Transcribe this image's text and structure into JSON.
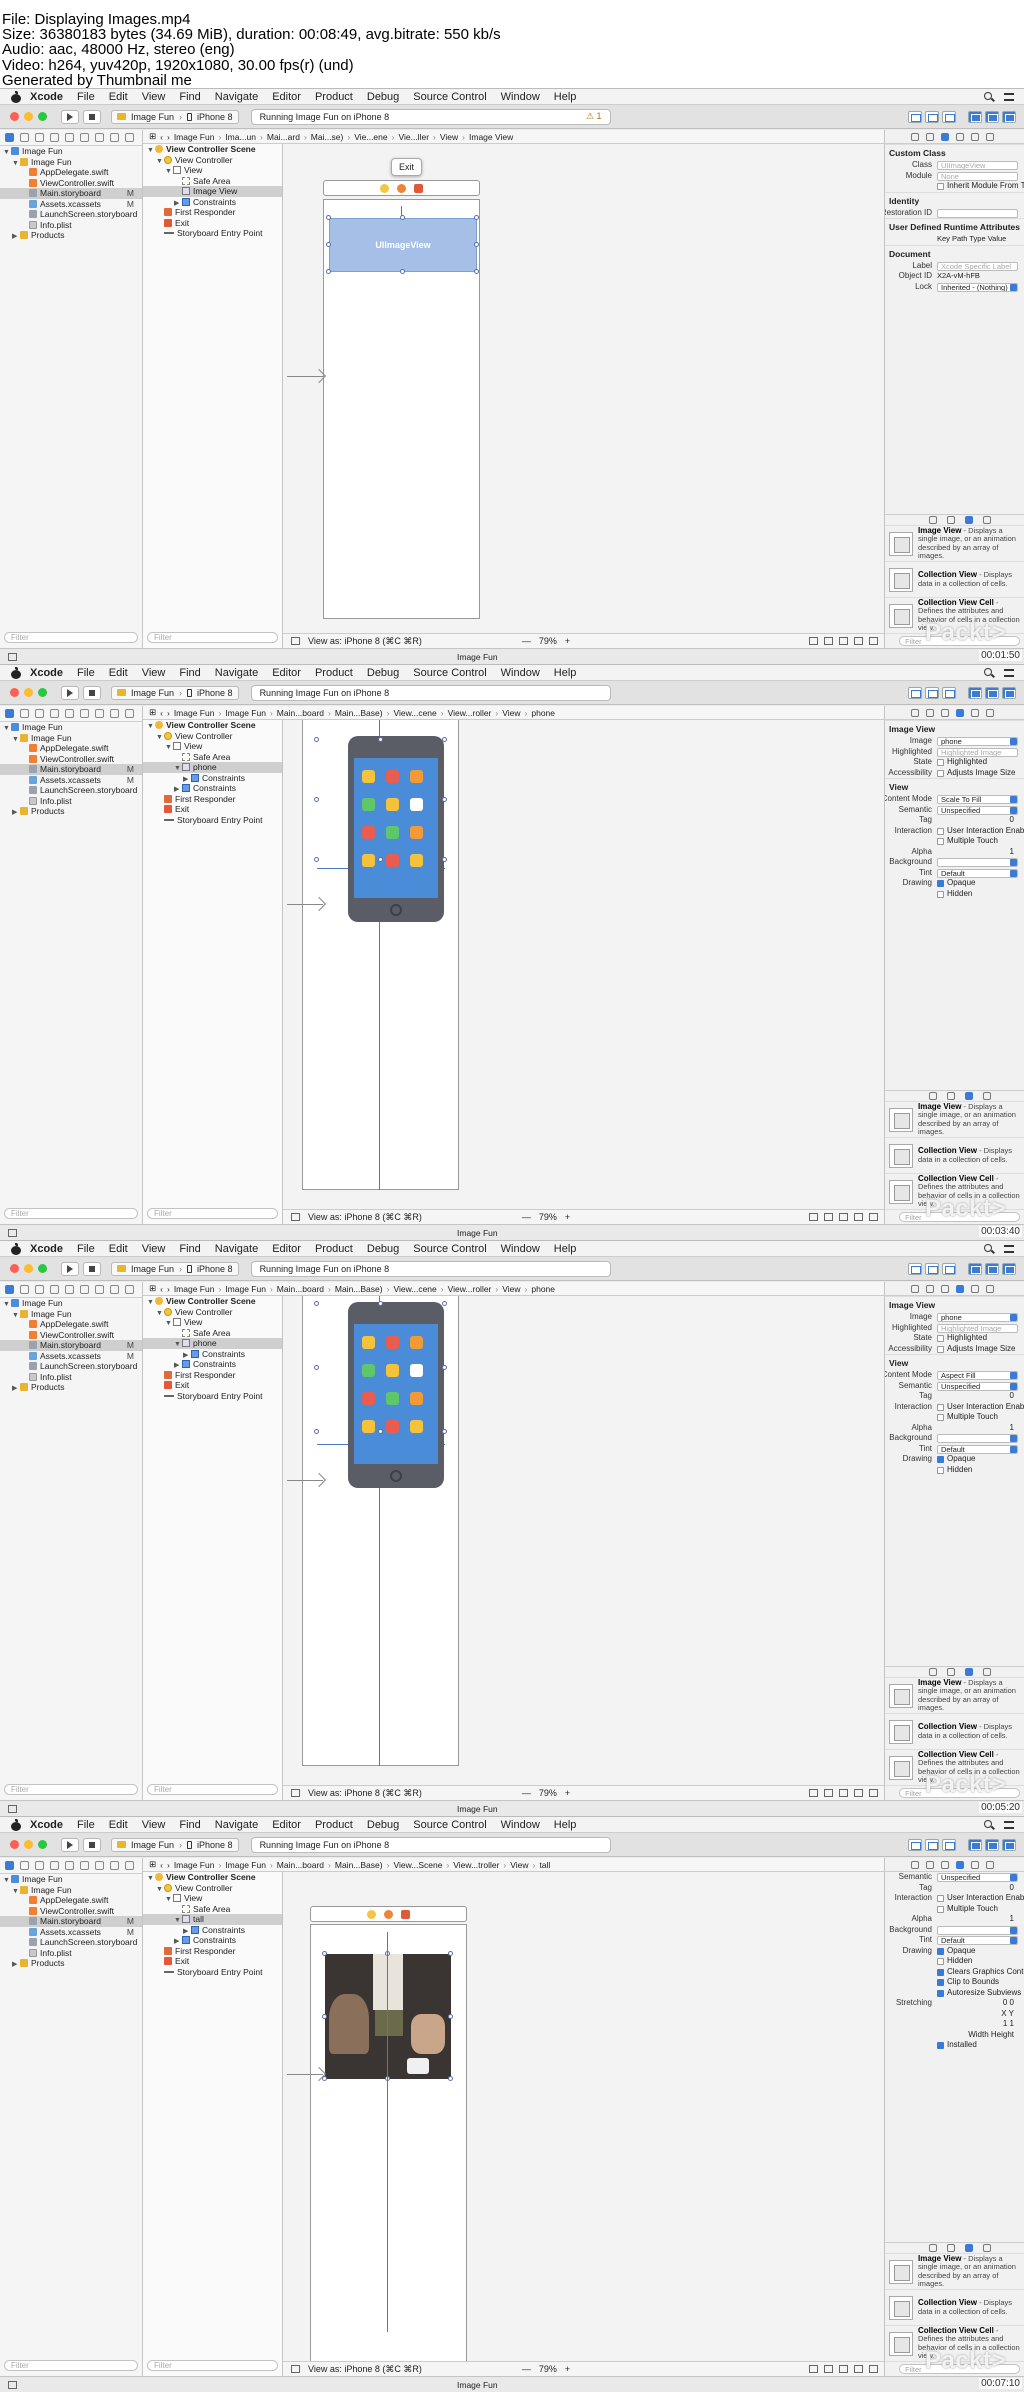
{
  "file_info": {
    "lines": [
      "File: Displaying Images.mp4",
      "Size: 36380183 bytes (34.69 MiB), duration: 00:08:49, avg.bitrate: 550 kb/s",
      "Audio: aac, 48000 Hz, stereo (eng)",
      "Video: h264, yuv420p, 1920x1080, 30.00 fps(r) (und)",
      "Generated by Thumbnail me"
    ]
  },
  "common": {
    "app_name": "Xcode",
    "menu": [
      "File",
      "Edit",
      "View",
      "Find",
      "Navigate",
      "Editor",
      "Product",
      "Debug",
      "Source Control",
      "Window",
      "Help"
    ],
    "scheme": "Image Fun",
    "device": "iPhone 8",
    "status": "Running Image Fun on iPhone 8",
    "nav_items": [
      {
        "label": "Image Fun",
        "icon": "project-icon",
        "indent": 0,
        "disc": "▼"
      },
      {
        "label": "Image Fun",
        "icon": "folder-icon",
        "indent": 1,
        "disc": "▼"
      },
      {
        "label": "AppDelegate.swift",
        "icon": "swift-file-icon",
        "indent": 2,
        "disc": ""
      },
      {
        "label": "ViewController.swift",
        "icon": "swift-file-icon",
        "indent": 2,
        "disc": ""
      },
      {
        "label": "Main.storyboard",
        "icon": "storyboard-file-icon",
        "indent": 2,
        "disc": "",
        "badge": "M",
        "selected": true
      },
      {
        "label": "Assets.xcassets",
        "icon": "assets-file-icon",
        "indent": 2,
        "disc": "",
        "badge": "M"
      },
      {
        "label": "LaunchScreen.storyboard",
        "icon": "storyboard-file-icon",
        "indent": 2,
        "disc": ""
      },
      {
        "label": "Info.plist",
        "icon": "plist-file-icon",
        "indent": 2,
        "disc": ""
      },
      {
        "label": "Products",
        "icon": "folder-icon",
        "indent": 1,
        "disc": "▶"
      }
    ],
    "filter_placeholder": "Filter",
    "view_as": "View as: iPhone 8 (⌘C ⌘R)",
    "debug_label": "Image Fun",
    "library": [
      {
        "title": "Image View",
        "desc": "- Displays a single image, or an animation described by an array of images."
      },
      {
        "title": "Collection View",
        "desc": "- Displays data in a collection of cells."
      },
      {
        "title": "Collection View Cell",
        "desc": "- Defines the attributes and behavior of cells in a collection view."
      }
    ],
    "watermark": "Packt>",
    "colors": {
      "accent": "#3b7bd6",
      "red_light": "#fc5f57",
      "yellow_light": "#fdbc2e",
      "green_light": "#29c840"
    }
  },
  "panels": [
    {
      "timecode": "00:01:50",
      "warn": "⚠ 1",
      "jump": [
        "Image Fun",
        "Ima...un",
        "Mai...ard",
        "Mai...se)",
        "Vie...ene",
        "Vie...ller",
        "View",
        "Image View"
      ],
      "outline": [
        {
          "label": "View Controller Scene",
          "icon": "scene-icon",
          "indent": 0,
          "disc": "▼",
          "bold": true
        },
        {
          "label": "View Controller",
          "icon": "view-controller-icon",
          "indent": 1,
          "disc": "▼"
        },
        {
          "label": "View",
          "icon": "view-icon",
          "indent": 2,
          "disc": "▼"
        },
        {
          "label": "Safe Area",
          "icon": "safe-area-icon",
          "indent": 3,
          "disc": ""
        },
        {
          "label": "Image View",
          "icon": "image-view-icon",
          "indent": 3,
          "disc": "",
          "selected": true
        },
        {
          "label": "Constraints",
          "icon": "constraints-icon",
          "indent": 3,
          "disc": "▶"
        },
        {
          "label": "First Responder",
          "icon": "first-responder-icon",
          "indent": 1,
          "disc": ""
        },
        {
          "label": "Exit",
          "icon": "exit-icon",
          "indent": 1,
          "disc": ""
        },
        {
          "label": "Storyboard Entry Point",
          "icon": "entry-point-icon",
          "indent": 1,
          "disc": ""
        }
      ],
      "zoom": "79%",
      "tooltip": "Exit",
      "image_label": "UIImageView",
      "inspector": {
        "sections": [
          {
            "title": "Custom Class",
            "props": [
              {
                "label": "Class",
                "value": "UIImageView",
                "type": "field-ph"
              },
              {
                "label": "Module",
                "value": "None",
                "type": "field-ph"
              },
              {
                "label": "",
                "value": "Inherit Module From Target",
                "type": "check"
              }
            ]
          },
          {
            "title": "Identity",
            "props": [
              {
                "label": "Restoration ID",
                "value": "",
                "type": "field"
              }
            ]
          },
          {
            "title": "User Defined Runtime Attributes",
            "props": [
              {
                "label": "",
                "value": "Key Path     Type     Value",
                "type": "text"
              }
            ]
          },
          {
            "title": "Document",
            "props": [
              {
                "label": "Label",
                "value": "Xcode Specific Label",
                "type": "field-ph"
              },
              {
                "label": "Object ID",
                "value": "X2A-vM-hFB",
                "type": "text"
              },
              {
                "label": "Lock",
                "value": "Inherited - (Nothing)",
                "type": "pop"
              }
            ]
          }
        ]
      }
    },
    {
      "timecode": "00:03:40",
      "jump": [
        "Image Fun",
        "Image Fun",
        "Main...board",
        "Main...Base)",
        "View...cene",
        "View...roller",
        "View",
        "phone"
      ],
      "outline": [
        {
          "label": "View Controller Scene",
          "icon": "scene-icon",
          "indent": 0,
          "disc": "▼",
          "bold": true
        },
        {
          "label": "View Controller",
          "icon": "view-controller-icon",
          "indent": 1,
          "disc": "▼"
        },
        {
          "label": "View",
          "icon": "view-icon",
          "indent": 2,
          "disc": "▼"
        },
        {
          "label": "Safe Area",
          "icon": "safe-area-icon",
          "indent": 3,
          "disc": ""
        },
        {
          "label": "phone",
          "icon": "image-view-icon",
          "indent": 3,
          "disc": "▼",
          "selected": true
        },
        {
          "label": "Constraints",
          "icon": "constraints-icon",
          "indent": 4,
          "disc": "▶"
        },
        {
          "label": "Constraints",
          "icon": "constraints-icon",
          "indent": 3,
          "disc": "▶"
        },
        {
          "label": "First Responder",
          "icon": "first-responder-icon",
          "indent": 1,
          "disc": ""
        },
        {
          "label": "Exit",
          "icon": "exit-icon",
          "indent": 1,
          "disc": ""
        },
        {
          "label": "Storyboard Entry Point",
          "icon": "entry-point-icon",
          "indent": 1,
          "disc": ""
        }
      ],
      "zoom": "79%",
      "inspector": {
        "sections": [
          {
            "title": "Image View",
            "props": [
              {
                "label": "Image",
                "value": "phone",
                "type": "pop"
              },
              {
                "label": "Highlighted",
                "value": "Highlighted Image",
                "type": "field-ph"
              },
              {
                "label": "State",
                "value": "Highlighted",
                "type": "check"
              },
              {
                "label": "Accessibility",
                "value": "Adjusts Image Size",
                "type": "check"
              }
            ]
          },
          {
            "title": "View",
            "props": [
              {
                "label": "Content Mode",
                "value": "Scale To Fill",
                "type": "pop"
              },
              {
                "label": "Semantic",
                "value": "Unspecified",
                "type": "pop"
              },
              {
                "label": "Tag",
                "value": "0",
                "type": "num"
              },
              {
                "label": "Interaction",
                "value": "User Interaction Enabled",
                "type": "check"
              },
              {
                "label": "",
                "value": "Multiple Touch",
                "type": "check"
              },
              {
                "label": "Alpha",
                "value": "1",
                "type": "num"
              },
              {
                "label": "Background",
                "value": "",
                "type": "pop"
              },
              {
                "label": "Tint",
                "value": "Default",
                "type": "pop"
              },
              {
                "label": "Drawing",
                "value": "Opaque",
                "type": "check-on"
              },
              {
                "label": "",
                "value": "Hidden",
                "type": "check"
              }
            ]
          }
        ]
      }
    },
    {
      "timecode": "00:05:20",
      "jump": [
        "Image Fun",
        "Image Fun",
        "Main...board",
        "Main...Base)",
        "View...cene",
        "View...roller",
        "View",
        "phone"
      ],
      "outline": [
        {
          "label": "View Controller Scene",
          "icon": "scene-icon",
          "indent": 0,
          "disc": "▼",
          "bold": true
        },
        {
          "label": "View Controller",
          "icon": "view-controller-icon",
          "indent": 1,
          "disc": "▼"
        },
        {
          "label": "View",
          "icon": "view-icon",
          "indent": 2,
          "disc": "▼"
        },
        {
          "label": "Safe Area",
          "icon": "safe-area-icon",
          "indent": 3,
          "disc": ""
        },
        {
          "label": "phone",
          "icon": "image-view-icon",
          "indent": 3,
          "disc": "▼",
          "selected": true
        },
        {
          "label": "Constraints",
          "icon": "constraints-icon",
          "indent": 4,
          "disc": "▶"
        },
        {
          "label": "Constraints",
          "icon": "constraints-icon",
          "indent": 3,
          "disc": "▶"
        },
        {
          "label": "First Responder",
          "icon": "first-responder-icon",
          "indent": 1,
          "disc": ""
        },
        {
          "label": "Exit",
          "icon": "exit-icon",
          "indent": 1,
          "disc": ""
        },
        {
          "label": "Storyboard Entry Point",
          "icon": "entry-point-icon",
          "indent": 1,
          "disc": ""
        }
      ],
      "zoom": "79%",
      "inspector": {
        "sections": [
          {
            "title": "Image View",
            "props": [
              {
                "label": "Image",
                "value": "phone",
                "type": "pop"
              },
              {
                "label": "Highlighted",
                "value": "Highlighted Image",
                "type": "field-ph"
              },
              {
                "label": "State",
                "value": "Highlighted",
                "type": "check"
              },
              {
                "label": "Accessibility",
                "value": "Adjusts Image Size",
                "type": "check"
              }
            ]
          },
          {
            "title": "View",
            "props": [
              {
                "label": "Content Mode",
                "value": "Aspect Fill",
                "type": "pop"
              },
              {
                "label": "Semantic",
                "value": "Unspecified",
                "type": "pop"
              },
              {
                "label": "Tag",
                "value": "0",
                "type": "num"
              },
              {
                "label": "Interaction",
                "value": "User Interaction Enabled",
                "type": "check"
              },
              {
                "label": "",
                "value": "Multiple Touch",
                "type": "check"
              },
              {
                "label": "Alpha",
                "value": "1",
                "type": "num"
              },
              {
                "label": "Background",
                "value": "",
                "type": "pop"
              },
              {
                "label": "Tint",
                "value": "Default",
                "type": "pop"
              },
              {
                "label": "Drawing",
                "value": "Opaque",
                "type": "check-on"
              },
              {
                "label": "",
                "value": "Hidden",
                "type": "check"
              }
            ]
          }
        ]
      }
    },
    {
      "timecode": "00:07:10",
      "jump": [
        "Image Fun",
        "Image Fun",
        "Main...board",
        "Main...Base)",
        "View...Scene",
        "View...troller",
        "View",
        "tall"
      ],
      "outline": [
        {
          "label": "View Controller Scene",
          "icon": "scene-icon",
          "indent": 0,
          "disc": "▼",
          "bold": true
        },
        {
          "label": "View Controller",
          "icon": "view-controller-icon",
          "indent": 1,
          "disc": "▼"
        },
        {
          "label": "View",
          "icon": "view-icon",
          "indent": 2,
          "disc": "▼"
        },
        {
          "label": "Safe Area",
          "icon": "safe-area-icon",
          "indent": 3,
          "disc": ""
        },
        {
          "label": "tall",
          "icon": "image-view-icon",
          "indent": 3,
          "disc": "▼",
          "selected": true
        },
        {
          "label": "Constraints",
          "icon": "constraints-icon",
          "indent": 4,
          "disc": "▶"
        },
        {
          "label": "Constraints",
          "icon": "constraints-icon",
          "indent": 3,
          "disc": "▶"
        },
        {
          "label": "First Responder",
          "icon": "first-responder-icon",
          "indent": 1,
          "disc": ""
        },
        {
          "label": "Exit",
          "icon": "exit-icon",
          "indent": 1,
          "disc": ""
        },
        {
          "label": "Storyboard Entry Point",
          "icon": "entry-point-icon",
          "indent": 1,
          "disc": ""
        }
      ],
      "zoom": "79%",
      "inspector": {
        "sections": [
          {
            "title": "",
            "props": [
              {
                "label": "Semantic",
                "value": "Unspecified",
                "type": "pop"
              },
              {
                "label": "Tag",
                "value": "0",
                "type": "num"
              },
              {
                "label": "Interaction",
                "value": "User Interaction Enabled",
                "type": "check"
              },
              {
                "label": "",
                "value": "Multiple Touch",
                "type": "check"
              },
              {
                "label": "Alpha",
                "value": "1",
                "type": "num"
              },
              {
                "label": "Background",
                "value": "",
                "type": "pop"
              },
              {
                "label": "Tint",
                "value": "Default",
                "type": "pop"
              },
              {
                "label": "Drawing",
                "value": "Opaque",
                "type": "check-on"
              },
              {
                "label": "",
                "value": "Hidden",
                "type": "check"
              },
              {
                "label": "",
                "value": "Clears Graphics Context",
                "type": "check-on"
              },
              {
                "label": "",
                "value": "Clip to Bounds",
                "type": "check-on"
              },
              {
                "label": "",
                "value": "Autoresize Subviews",
                "type": "check-on"
              },
              {
                "label": "Stretching",
                "value": "0          0",
                "type": "num"
              },
              {
                "label": "",
                "value": "X             Y",
                "type": "num"
              },
              {
                "label": "",
                "value": "1          1",
                "type": "num"
              },
              {
                "label": "",
                "value": "Width     Height",
                "type": "num"
              },
              {
                "label": "",
                "value": "Installed",
                "type": "check-on"
              }
            ]
          }
        ]
      }
    }
  ]
}
